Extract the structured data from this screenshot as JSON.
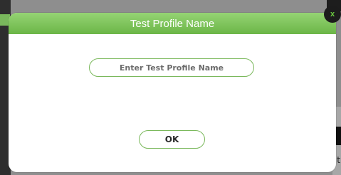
{
  "dialog": {
    "title": "Test Profile Name",
    "input": {
      "value": "",
      "placeholder": "Enter Test Profile Name"
    },
    "ok_label": "OK",
    "close_label": "x"
  },
  "background": {
    "partial_text": "t"
  },
  "colors": {
    "header_green": "#7ec65c",
    "border_green": "#7ab85b",
    "close_x": "#6ac73f",
    "overlay": "#8e8e8e"
  }
}
